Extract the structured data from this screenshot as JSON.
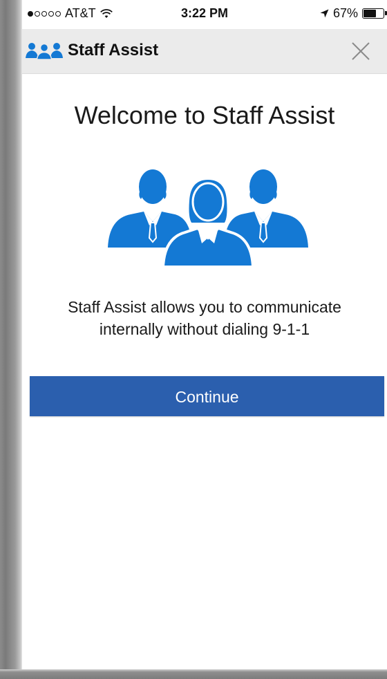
{
  "status_bar": {
    "carrier": "AT&T",
    "time": "3:22 PM",
    "battery_percent": "67%",
    "battery_level": 0.67,
    "signal_strength": 1,
    "signal_max": 5
  },
  "nav": {
    "title": "Staff Assist",
    "logo_icon": "people-group-icon",
    "close_icon": "close-icon"
  },
  "main": {
    "welcome_title": "Welcome to Staff Assist",
    "hero_icon": "staff-group-icon",
    "description_line1": "Staff Assist allows you to communicate",
    "description_line2": "internally without dialing 9-1-1",
    "continue_label": "Continue"
  },
  "colors": {
    "accent": "#2b5fae",
    "icon_blue": "#1479d4",
    "nav_background": "#ebebeb"
  }
}
